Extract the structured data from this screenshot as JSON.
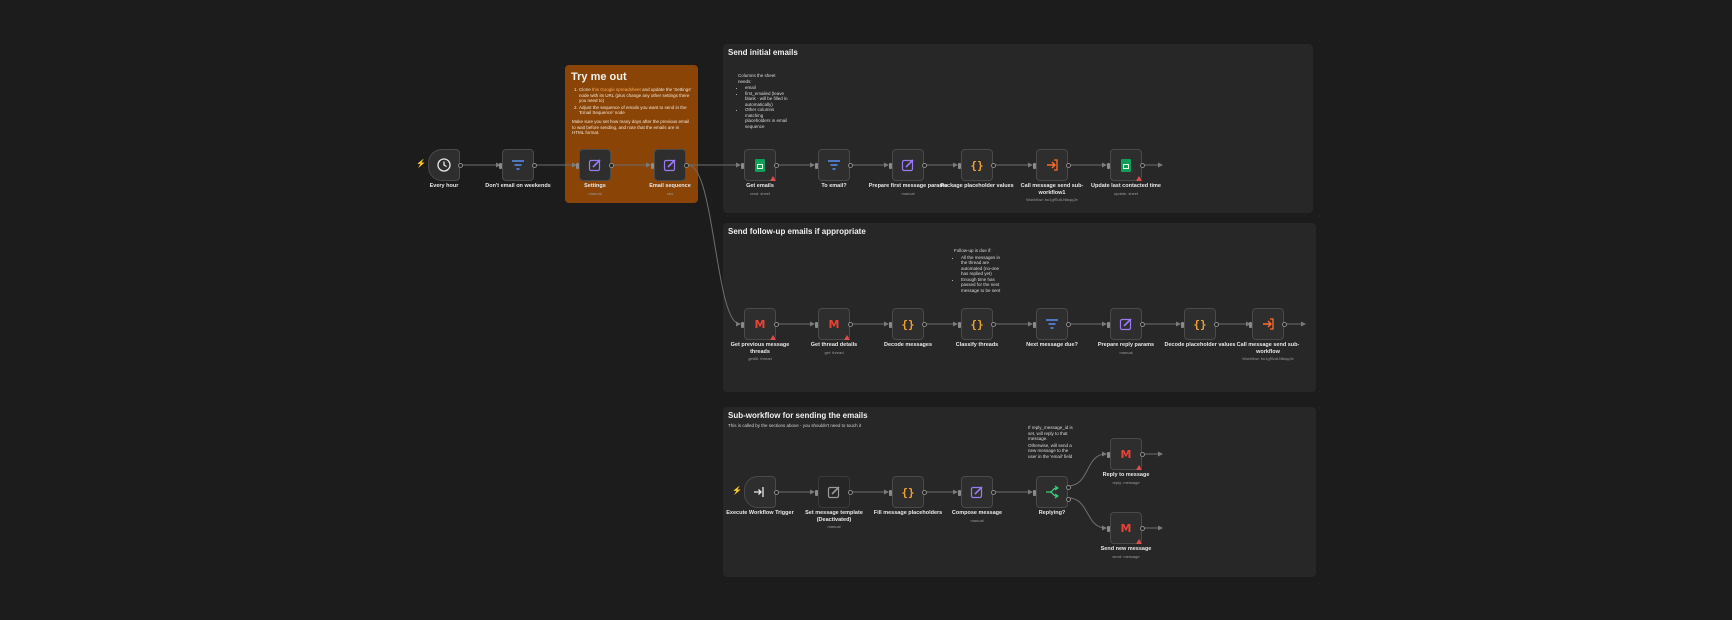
{
  "colors": {
    "canvas": "#1c1c1c",
    "section": "#272727",
    "sticky_orange": "#8a4406",
    "accent_trigger": "#ff6d2a",
    "filter_blue": "#5a8df0",
    "edit_purple": "#9b7af5",
    "code_orange": "#f0a230"
  },
  "sections": {
    "initial": {
      "title": "Send initial emails"
    },
    "followup": {
      "title": "Send follow-up emails if appropriate"
    },
    "subworkflow": {
      "title": "Sub-workflow for sending the emails",
      "subtitle": "This is called by the sections above - you shouldn't need to touch it"
    }
  },
  "try_me": {
    "title": "Try me out",
    "steps": [
      {
        "prefix": "Clone ",
        "link": "this Google spreadsheet",
        "rest": " and update the 'Settings' node with its URL (plus change any other settings there you need to)"
      },
      {
        "prefix": "Adjust the sequence of emails you want to send in the 'Email Sequence' node",
        "link": "",
        "rest": ""
      }
    ],
    "note": "Make sure you set how many days after the previous email to wait before sending, and note that the emails are in HTML format."
  },
  "notes": {
    "columns": {
      "intro": "Columns the sheet needs:",
      "items": [
        "email",
        "first_emailed (leave blank - will be filled in automatically)",
        "Other columns matching placeholders in email sequence"
      ]
    },
    "followup": {
      "intro": "Follow-up is due if:",
      "items": [
        "All the messages in the thread are automated (no-one has replied yet)",
        "Enough time has passed for the next message to be sent"
      ]
    },
    "replying": {
      "p1": "If reply_message_id is set, will reply to that message.",
      "p2": "Otherwise, will send a new message to the user in the 'email' field"
    }
  },
  "nodes": {
    "every_hour": {
      "label": "Every hour",
      "icon": "clock-icon"
    },
    "dont_email_weekends": {
      "label": "Don't email on weekends",
      "icon": "filter-icon"
    },
    "settings": {
      "label": "Settings",
      "sub": "manual",
      "icon": "pencil-icon"
    },
    "email_sequence": {
      "label": "Email sequence",
      "sub": "raw",
      "icon": "pencil-icon"
    },
    "get_emails": {
      "label": "Get emails",
      "sub": "read: sheet",
      "icon": "google-sheets-icon"
    },
    "to_email": {
      "label": "To email?",
      "icon": "filter-icon"
    },
    "prepare_first": {
      "label": "Prepare first message params",
      "sub": "manual",
      "icon": "pencil-icon"
    },
    "package_placeholder": {
      "label": "Package placeholder values",
      "icon": "code-icon"
    },
    "call_send_1": {
      "label": "Call message send sub-workflow1",
      "sub": "Workflow: bu1gfSutLNtkqqJe",
      "icon": "execute-workflow-icon"
    },
    "update_last_contacted": {
      "label": "Update last contacted time",
      "sub": "update: sheet",
      "icon": "google-sheets-icon"
    },
    "get_prev_threads": {
      "label": "Get previous message threads",
      "sub": "getAll: thread",
      "icon": "gmail-icon"
    },
    "get_thread_details": {
      "label": "Get thread details",
      "sub": "get: thread",
      "icon": "gmail-icon"
    },
    "decode_messages": {
      "label": "Decode messages",
      "icon": "code-icon"
    },
    "classify_threads": {
      "label": "Classify threads",
      "icon": "code-icon"
    },
    "next_message_due": {
      "label": "Next message due?",
      "icon": "filter-icon"
    },
    "prepare_reply": {
      "label": "Prepare reply params",
      "sub": "manual",
      "icon": "pencil-icon"
    },
    "decode_placeholder": {
      "label": "Decode placeholder values",
      "icon": "code-icon"
    },
    "call_send_2": {
      "label": "Call message send sub-workflow",
      "sub": "Workflow: bu1gfSutLNtkqqJe",
      "icon": "execute-workflow-icon"
    },
    "exec_trigger": {
      "label": "Execute Workflow Trigger",
      "icon": "sign-in-icon"
    },
    "set_template": {
      "label": "Set message template (Deactivated)",
      "sub": "manual",
      "icon": "pencil-icon"
    },
    "fill_placeholders": {
      "label": "Fill message placeholders",
      "icon": "code-icon"
    },
    "compose_message": {
      "label": "Compose message",
      "sub": "manual",
      "icon": "pencil-icon"
    },
    "replying": {
      "label": "Replying?",
      "icon": "if-branch-icon"
    },
    "reply_to_message": {
      "label": "Reply to message",
      "sub": "reply: message",
      "icon": "gmail-icon"
    },
    "send_new_message": {
      "label": "Send new message",
      "sub": "send: message",
      "icon": "gmail-icon"
    }
  }
}
